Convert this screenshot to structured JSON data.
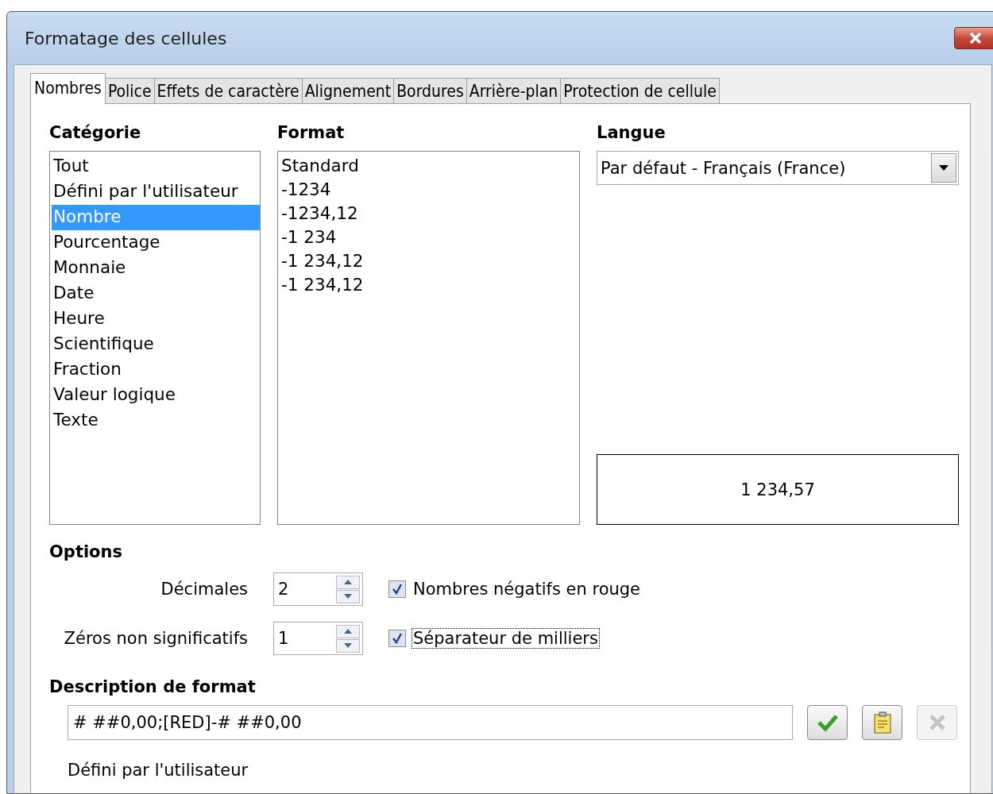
{
  "window": {
    "title": "Formatage des cellules"
  },
  "tabs": [
    {
      "label": "Nombres",
      "selected": true
    },
    {
      "label": "Police",
      "selected": false
    },
    {
      "label": "Effets de caractère",
      "selected": false
    },
    {
      "label": "Alignement",
      "selected": false
    },
    {
      "label": "Bordures",
      "selected": false
    },
    {
      "label": "Arrière-plan",
      "selected": false
    },
    {
      "label": "Protection de cellule",
      "selected": false
    }
  ],
  "category": {
    "label": "Catégorie",
    "items": [
      {
        "label": "Tout",
        "selected": false
      },
      {
        "label": "Défini par l'utilisateur",
        "selected": false
      },
      {
        "label": "Nombre",
        "selected": true
      },
      {
        "label": "Pourcentage",
        "selected": false
      },
      {
        "label": "Monnaie",
        "selected": false
      },
      {
        "label": "Date",
        "selected": false
      },
      {
        "label": "Heure",
        "selected": false
      },
      {
        "label": "Scientifique",
        "selected": false
      },
      {
        "label": "Fraction",
        "selected": false
      },
      {
        "label": "Valeur logique",
        "selected": false
      },
      {
        "label": "Texte",
        "selected": false
      }
    ]
  },
  "format": {
    "label": "Format",
    "items": [
      {
        "label": "Standard",
        "selected": false
      },
      {
        "label": "-1234",
        "selected": false
      },
      {
        "label": "-1234,12",
        "selected": false
      },
      {
        "label": "-1 234",
        "selected": false
      },
      {
        "label": "-1 234,12",
        "selected": false
      },
      {
        "label": "-1 234,12",
        "selected": false
      }
    ]
  },
  "language": {
    "label": "Langue",
    "value": "Par défaut - Français (France)"
  },
  "preview": "1 234,57",
  "options": {
    "label": "Options",
    "spinners": [
      {
        "label": "Décimales",
        "value": "2"
      },
      {
        "label": "Zéros non significatifs",
        "value": "1"
      }
    ],
    "checkboxes": [
      {
        "label": "Nombres négatifs en rouge",
        "checked": true,
        "focused": false
      },
      {
        "label": "Séparateur de milliers",
        "checked": true,
        "focused": true
      }
    ]
  },
  "format_code": {
    "label": "Description de format",
    "value": "# ##0,00;[RED]-# ##0,00",
    "buttons": [
      {
        "kind": "accept",
        "disabled": false
      },
      {
        "kind": "comment",
        "disabled": false
      },
      {
        "kind": "delete",
        "disabled": true
      }
    ],
    "note": "Défini par l'utilisateur"
  }
}
